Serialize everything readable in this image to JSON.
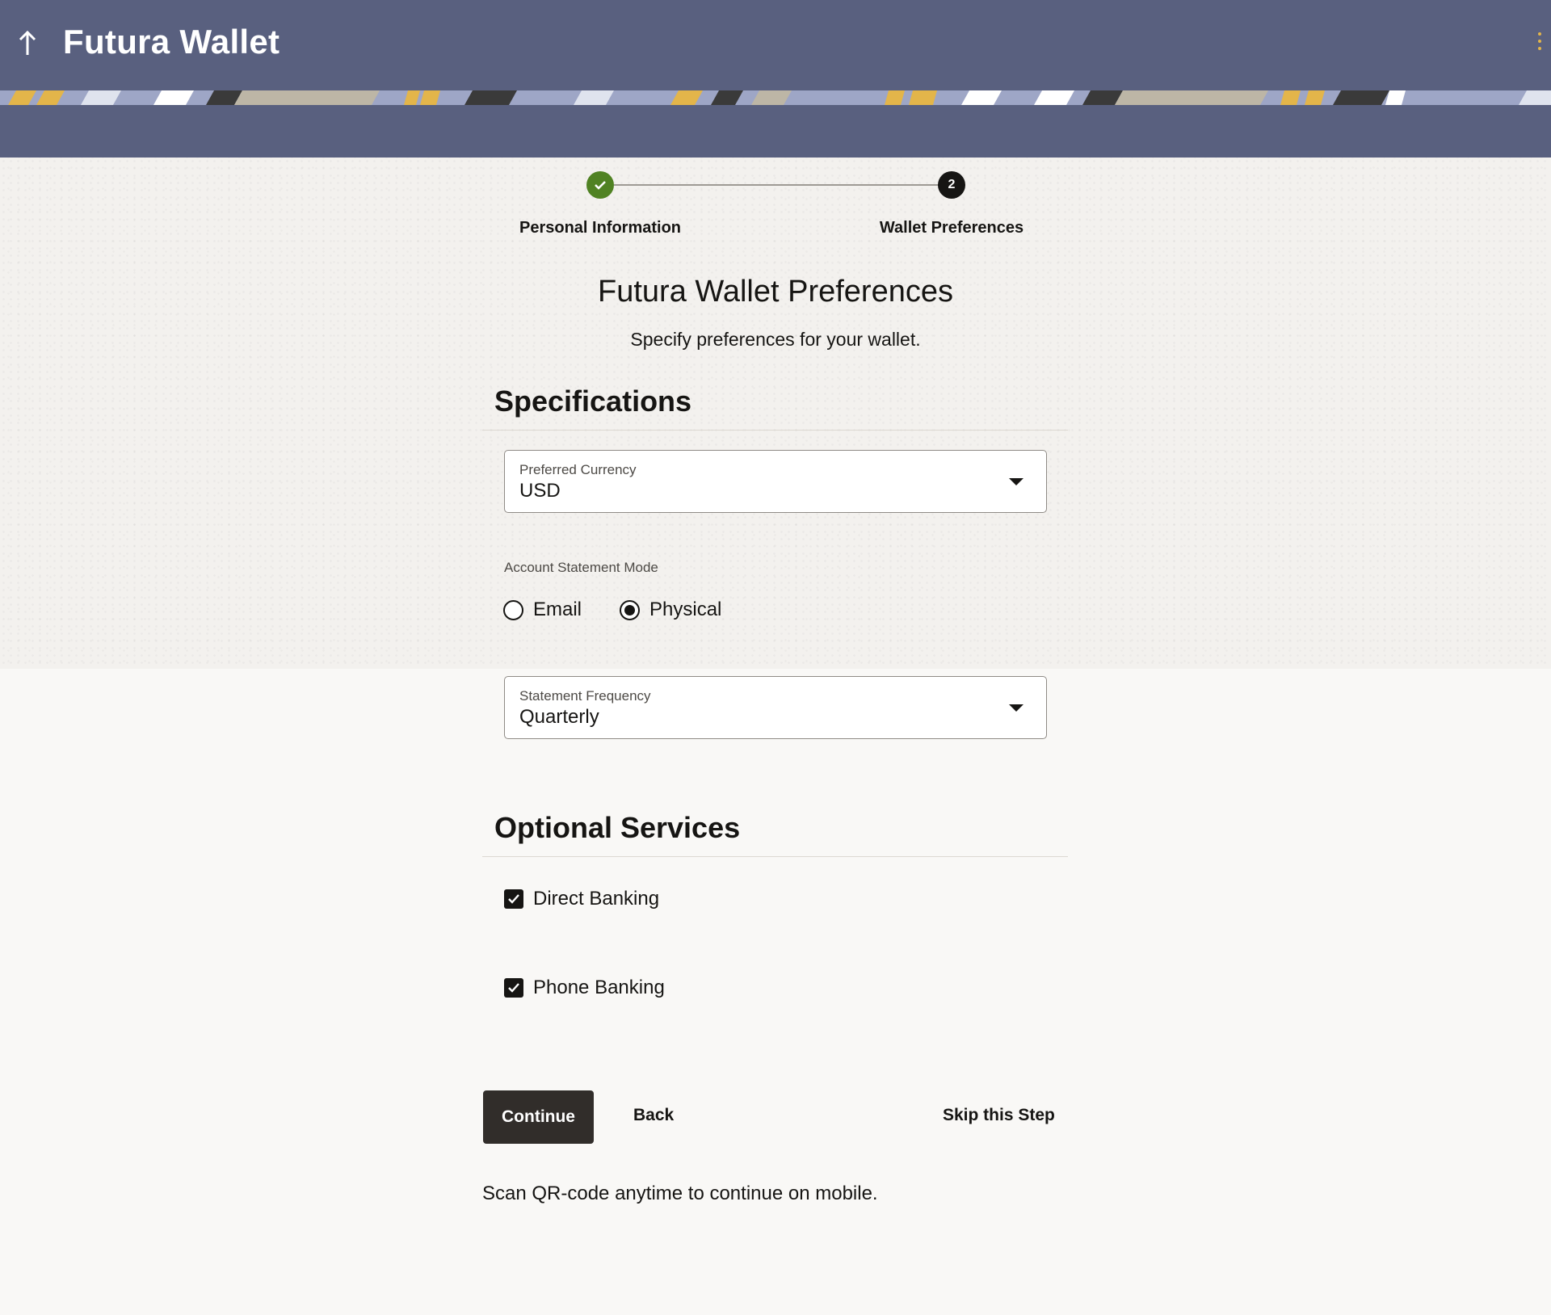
{
  "header": {
    "title": "Futura Wallet",
    "back_icon": "arrow-up-icon",
    "menu_icon": "kebab-menu-icon",
    "background_color": "#59607f"
  },
  "stepper": {
    "steps": [
      {
        "label": "Personal Information",
        "status": "complete",
        "icon": "check-icon"
      },
      {
        "label": "Wallet Preferences",
        "status": "current",
        "number": "2"
      }
    ]
  },
  "main": {
    "title": "Futura Wallet Preferences",
    "subtitle": "Specify preferences for your wallet."
  },
  "specifications": {
    "heading": "Specifications",
    "preferred_currency": {
      "label": "Preferred Currency",
      "value": "USD"
    },
    "statement_mode": {
      "label": "Account Statement Mode",
      "options": [
        {
          "label": "Email",
          "selected": false
        },
        {
          "label": "Physical",
          "selected": true
        }
      ]
    },
    "statement_frequency": {
      "label": "Statement Frequency",
      "value": "Quarterly"
    }
  },
  "optional_services": {
    "heading": "Optional Services",
    "items": [
      {
        "label": "Direct Banking",
        "checked": true
      },
      {
        "label": "Phone Banking",
        "checked": true
      }
    ]
  },
  "actions": {
    "continue_label": "Continue",
    "back_label": "Back",
    "skip_label": "Skip this Step"
  },
  "footer_note": "Scan QR-code anytime to continue on mobile.",
  "colors": {
    "accent_dark": "#312d2a",
    "step_complete": "#508223",
    "step_current": "#161513"
  }
}
